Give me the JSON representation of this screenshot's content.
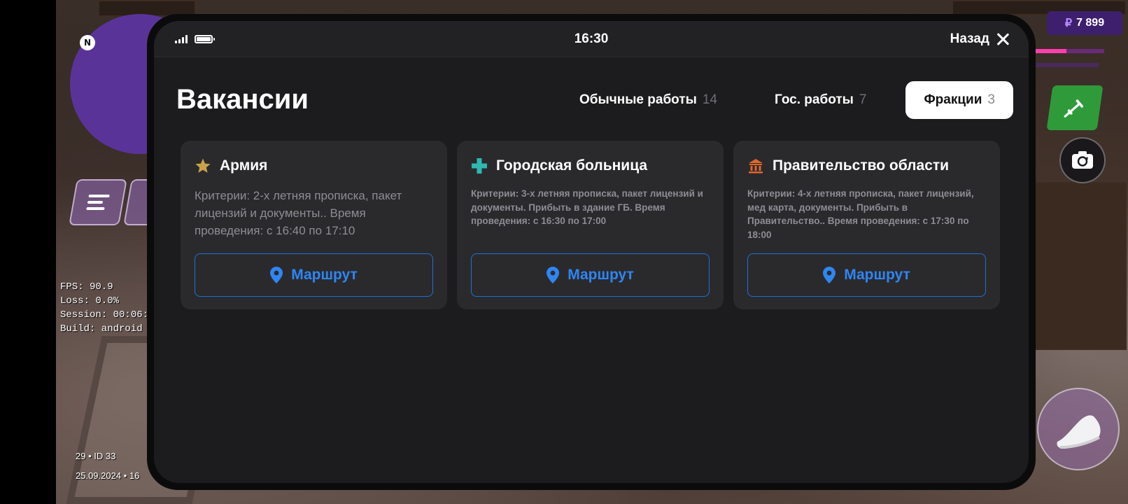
{
  "hud": {
    "money_currency": "₽",
    "money_value": "7 899",
    "debug": {
      "fps": "FPS: 90.9",
      "loss": "Loss: 0.0%",
      "session": "Session: 00:06:",
      "build": "Build: android g"
    },
    "id_line": "29 • ID 33",
    "date_line": "25.09.2024 • 16",
    "badge_letter": "N"
  },
  "status_bar": {
    "time": "16:30",
    "back_label": "Назад"
  },
  "page": {
    "title": "Вакансии"
  },
  "tabs": [
    {
      "label": "Обычные работы",
      "count": "14",
      "active": false
    },
    {
      "label": "Гос. работы",
      "count": "7",
      "active": false
    },
    {
      "label": "Фракции",
      "count": "3",
      "active": true
    }
  ],
  "cards": [
    {
      "icon": "star-icon",
      "title": "Армия",
      "description": "Критерии: 2-х летняя прописка, пакет лицензий и документы.. Время проведения: с 16:40 по 17:10",
      "button": "Маршрут"
    },
    {
      "icon": "medical-cross-icon",
      "title": "Городская больница",
      "description": "Критерии: 3-х летняя прописка, пакет лицензий и документы. Прибыть в здание ГБ. Время проведения: с 16:30 по 17:00",
      "button": "Маршрут"
    },
    {
      "icon": "government-building-icon",
      "title": "Правительство области",
      "description": "Критерии: 4-х летняя прописка, пакет лицензий, мед карта, документы. Прибыть в Правительство.. Время проведения: с 17:30 по 18:00",
      "button": "Маршрут"
    }
  ],
  "colors": {
    "accent_blue": "#2f86f2",
    "star": "#c9a34a",
    "cross": "#2fb7b0",
    "government": "#e0662b",
    "screen_bg": "#1c1c1e",
    "card_bg": "#2a2a2d"
  }
}
